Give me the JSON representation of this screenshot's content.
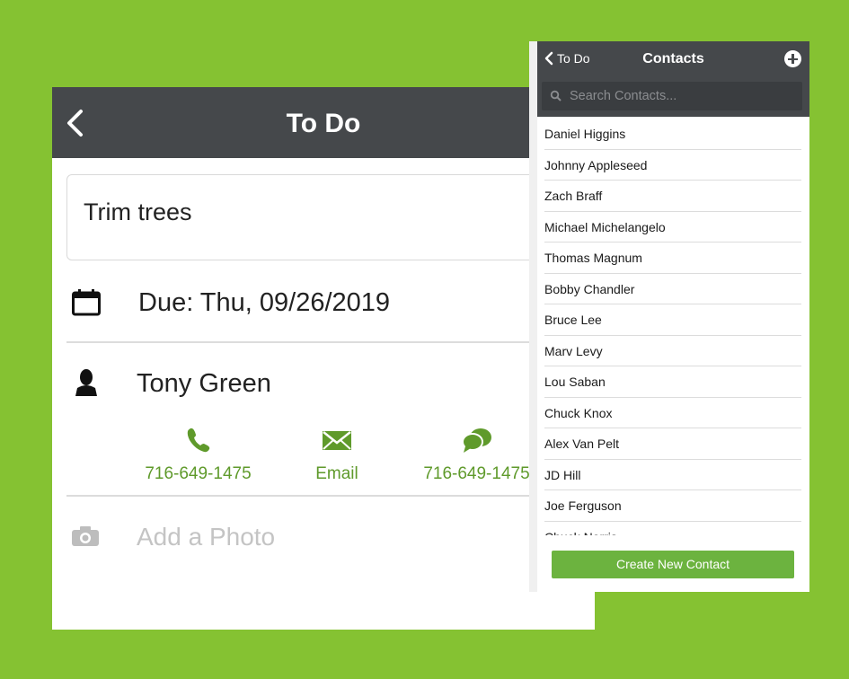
{
  "todo": {
    "title": "To Do",
    "task": "Trim trees",
    "due": "Due: Thu, 09/26/2019",
    "contact_name": "Tony Green",
    "actions": [
      {
        "icon": "phone-icon",
        "label": "716-649-1475"
      },
      {
        "icon": "email-icon",
        "label": "Email"
      },
      {
        "icon": "chat-icon",
        "label": "716-649-1475"
      }
    ],
    "photo_label": "Add a Photo"
  },
  "contacts": {
    "back_label": "To Do",
    "title": "Contacts",
    "search_placeholder": "Search Contacts...",
    "items": [
      "Daniel Higgins",
      "Johnny Appleseed",
      "Zach Braff",
      "Michael Michelangelo",
      "Thomas Magnum",
      "Bobby Chandler",
      "Bruce Lee",
      "Marv Levy",
      "Lou Saban",
      "Chuck Knox",
      "Alex Van Pelt",
      "JD Hill",
      "Joe Ferguson",
      "Chuck Norris"
    ],
    "create_button": "Create New Contact"
  },
  "colors": {
    "background": "#85c232",
    "header": "#45484b",
    "accent": "#5f9a2b",
    "button": "#6cb33f"
  }
}
